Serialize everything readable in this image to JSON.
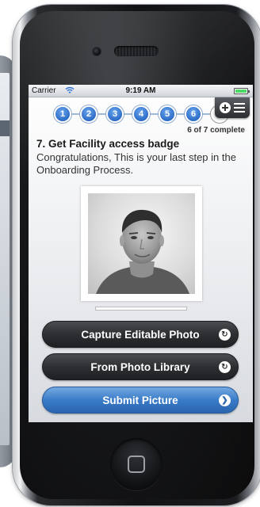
{
  "status_bar": {
    "carrier": "Carrier",
    "time": "9:19 AM",
    "battery_level": 1.0
  },
  "progress": {
    "steps": [
      "1",
      "2",
      "3",
      "4",
      "5",
      "6"
    ],
    "current_step": 7,
    "summary": "6 of 7 complete"
  },
  "menu": {
    "add_icon": "plus-circle-icon",
    "list_icon": "list-icon"
  },
  "step": {
    "title": "7. Get Facility access badge",
    "description": "Congratulations, This is your last step in the Onboarding Process."
  },
  "buttons": {
    "capture_label": "Capture Editable Photo",
    "library_label": "From Photo Library",
    "submit_label": "Submit Picture"
  },
  "colors": {
    "accent_blue": "#3a7bc8",
    "button_dark": "#2e2f32",
    "step_blue": "#2c6cc7"
  }
}
